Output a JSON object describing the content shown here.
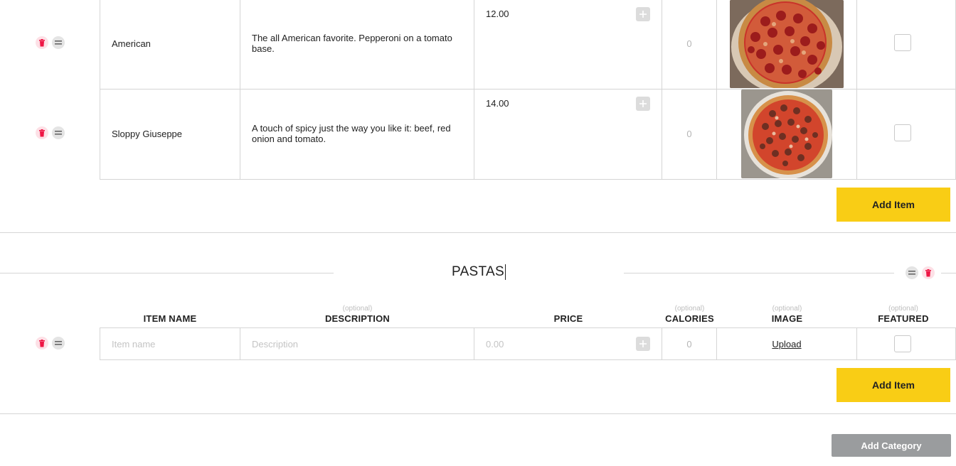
{
  "pizza_items": [
    {
      "name": "American",
      "description": "The all American favorite. Pepperoni on a tomato base.",
      "price": "12.00",
      "calories": "0",
      "image": "pepperoni-pizza"
    },
    {
      "name": "Sloppy Giuseppe",
      "description": "A touch of spicy just the way you like it: beef, red onion and tomato.",
      "price": "14.00",
      "calories": "0",
      "image": "beef-pizza"
    }
  ],
  "add_item_label": "Add Item",
  "category": {
    "title": "PASTAS"
  },
  "columns": {
    "item_name": {
      "label": "ITEM NAME",
      "optional": ""
    },
    "description": {
      "label": "DESCRIPTION",
      "optional": "(optional)"
    },
    "price": {
      "label": "PRICE",
      "optional": ""
    },
    "calories": {
      "label": "CALORIES",
      "optional": "(optional)"
    },
    "image": {
      "label": "IMAGE",
      "optional": "(optional)"
    },
    "featured": {
      "label": "FEATURED",
      "optional": "(optional)"
    }
  },
  "new_item": {
    "name_placeholder": "Item name",
    "description_placeholder": "Description",
    "price_placeholder": "0.00",
    "calories": "0",
    "upload_label": "Upload"
  },
  "add_category_label": "Add Category",
  "colors": {
    "accent_yellow": "#f9cd15",
    "delete_red": "#ee1645",
    "secondary_gray": "#9a9c9e"
  },
  "icons": [
    "trash-icon",
    "drag-handle-icon",
    "plus-icon"
  ]
}
